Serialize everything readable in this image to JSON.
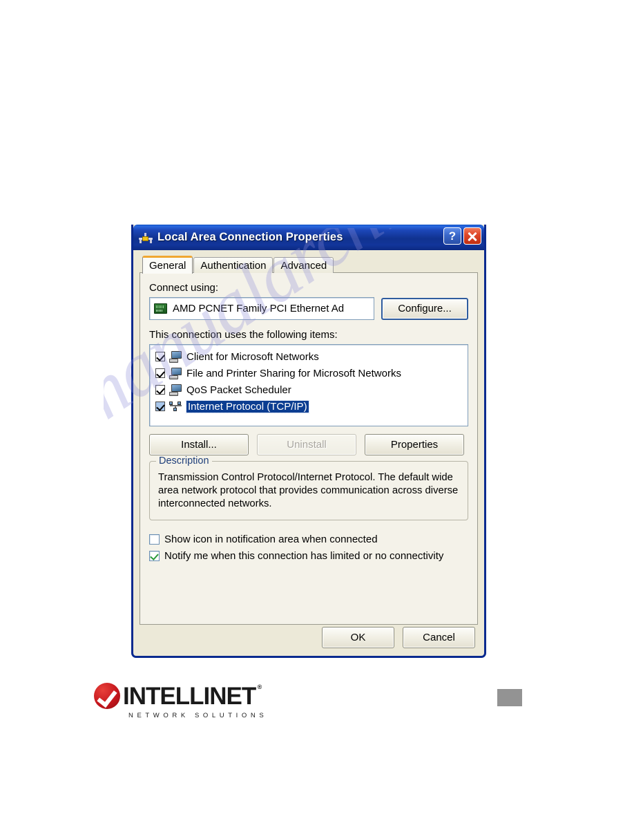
{
  "page": {
    "background": "#ffffff",
    "watermark_text": "manualarchive.com"
  },
  "dialog": {
    "title": "Local Area Connection Properties",
    "window_icon": "network-connection-icon",
    "title_buttons": [
      {
        "name": "help-button",
        "label": "?"
      },
      {
        "name": "close-button",
        "label": "×"
      }
    ],
    "colors": {
      "titlebar": "#12359a",
      "client": "#ece9d8",
      "panel": "#f4f2e9",
      "selection": "#0b3d91",
      "active_tab_accent": "#f0a732",
      "close_button": "#c12e12"
    },
    "tabs": [
      {
        "label": "General",
        "active": true
      },
      {
        "label": "Authentication",
        "active": false
      },
      {
        "label": "Advanced",
        "active": false
      }
    ],
    "connect_using": {
      "label": "Connect using:",
      "adapter": "AMD PCNET Family PCI Ethernet Ad",
      "adapter_icon": "network-adapter-icon",
      "configure_button": "Configure..."
    },
    "items_section": {
      "label": "This connection uses the following items:",
      "items": [
        {
          "label": "Client for Microsoft Networks",
          "checked": true,
          "selected": false,
          "icon": "computer-icon"
        },
        {
          "label": "File and Printer Sharing for Microsoft Networks",
          "checked": true,
          "selected": false,
          "icon": "computer-icon"
        },
        {
          "label": "QoS Packet Scheduler",
          "checked": true,
          "selected": false,
          "icon": "computer-icon"
        },
        {
          "label": "Internet Protocol (TCP/IP)",
          "checked": true,
          "selected": true,
          "icon": "network-protocol-icon"
        }
      ]
    },
    "action_buttons": [
      {
        "label": "Install...",
        "enabled": true
      },
      {
        "label": "Uninstall",
        "enabled": false
      },
      {
        "label": "Properties",
        "enabled": true
      }
    ],
    "description": {
      "title": "Description",
      "text": "Transmission Control Protocol/Internet Protocol. The default wide area network protocol that provides communication across diverse interconnected networks."
    },
    "options": [
      {
        "label": "Show icon in notification area when connected",
        "checked": false
      },
      {
        "label": "Notify me when this connection has limited or no connectivity",
        "checked": true
      }
    ],
    "footer_buttons": [
      {
        "label": "OK"
      },
      {
        "label": "Cancel"
      }
    ]
  },
  "branding": {
    "name": "INTELLINET",
    "trademark": "®",
    "tagline": "NETWORK SOLUTIONS",
    "mark_color": "#c4161c"
  }
}
